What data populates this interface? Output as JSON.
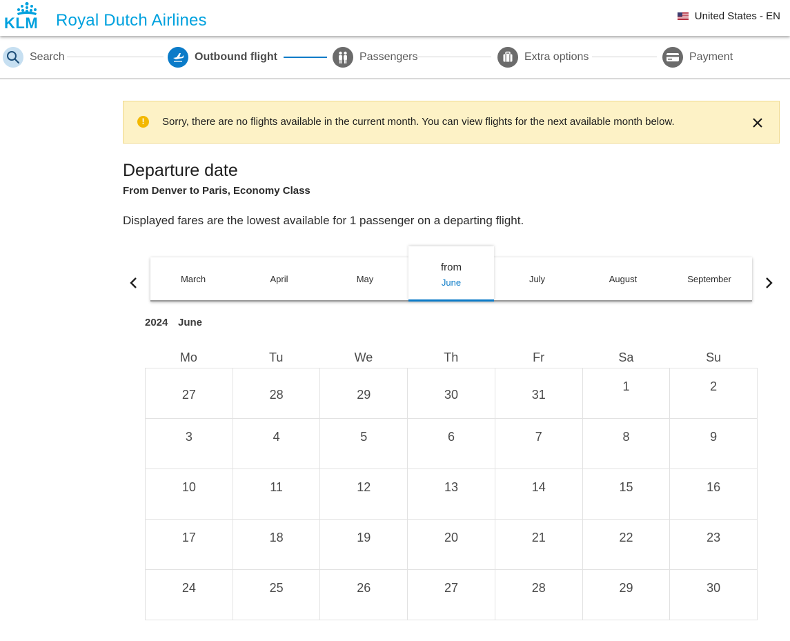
{
  "header": {
    "brand_mark": "KLM",
    "brand_name": "Royal Dutch Airlines",
    "locale_label": "United States - EN"
  },
  "stepper": {
    "steps": [
      {
        "label": "Search",
        "icon": "search-icon"
      },
      {
        "label": "Outbound flight",
        "icon": "plane-icon"
      },
      {
        "label": "Passengers",
        "icon": "passengers-icon"
      },
      {
        "label": "Extra options",
        "icon": "luggage-icon"
      },
      {
        "label": "Payment",
        "icon": "credit-card-icon"
      }
    ],
    "active_index": 1
  },
  "alert": {
    "message": "Sorry, there are no flights available in the current month. You can view flights for the next available month below."
  },
  "main": {
    "title": "Departure date",
    "route": "From Denver to Paris, Economy Class",
    "fares_note": "Displayed fares are the lowest available for 1 passenger on a departing flight."
  },
  "months": {
    "items": [
      "March",
      "April",
      "May",
      "June",
      "July",
      "August",
      "September"
    ],
    "selected_prefix": "from",
    "selected_index": 3
  },
  "calendar": {
    "year": "2024",
    "month": "June",
    "weekdays": [
      "Mo",
      "Tu",
      "We",
      "Th",
      "Fr",
      "Sa",
      "Su"
    ],
    "weeks": [
      [
        "27",
        "28",
        "29",
        "30",
        "31",
        "1",
        "2"
      ],
      [
        "3",
        "4",
        "5",
        "6",
        "7",
        "8",
        "9"
      ],
      [
        "10",
        "11",
        "12",
        "13",
        "14",
        "15",
        "16"
      ],
      [
        "17",
        "18",
        "19",
        "20",
        "21",
        "22",
        "23"
      ],
      [
        "24",
        "25",
        "26",
        "27",
        "28",
        "29",
        "30"
      ]
    ],
    "leading_outside_days": 5
  },
  "colors": {
    "brand": "#00a1de",
    "accent": "#0b7bc8",
    "alert_bg": "#fdf2c6",
    "warning": "#f3b800"
  }
}
